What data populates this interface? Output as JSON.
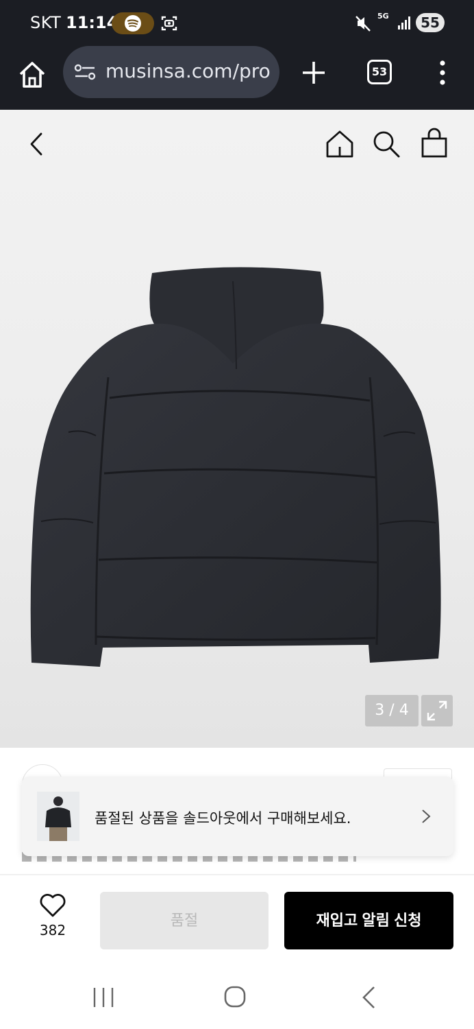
{
  "status_bar": {
    "carrier": "SKT",
    "time": "11:14",
    "network": "5G",
    "battery": "55",
    "icons": [
      "spotify-icon",
      "screen-record-icon",
      "mute-icon",
      "signal-icon"
    ]
  },
  "browser": {
    "url": "musinsa.com/pro",
    "tab_count": "53",
    "icons": [
      "home-icon",
      "site-settings-icon",
      "plus-icon",
      "more-vert-icon"
    ]
  },
  "product_page": {
    "nav_icons": [
      "back-arrow-icon",
      "home-icon",
      "search-icon",
      "shopping-bag-icon"
    ],
    "image_counter": "3 / 4",
    "expand_icon": "expand-icon"
  },
  "soldout_banner": {
    "text": "품절된 상품을 솔드아웃에서 구매해보세요."
  },
  "bottom_bar": {
    "like_count": "382",
    "soldout_label": "품절",
    "restock_label": "재입고 알림 신청"
  },
  "colors": {
    "system_bar": "#1b1d23",
    "url_pill": "#3a3e4a",
    "primary_button": "#000000",
    "disabled_button": "#e7e7e7",
    "counter_bg": "#c4c4c4"
  }
}
